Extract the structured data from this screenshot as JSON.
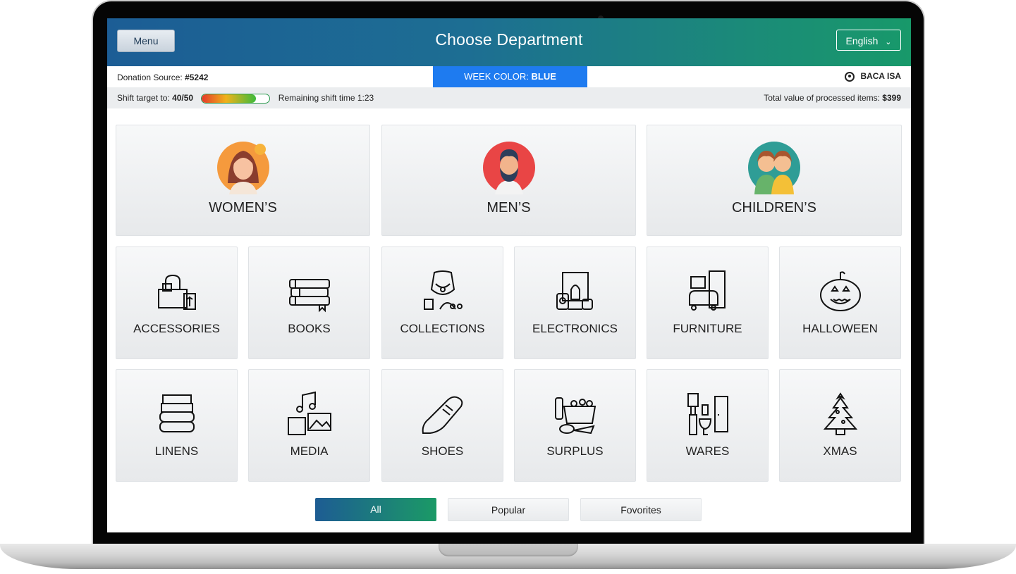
{
  "header": {
    "menu_label": "Menu",
    "title": "Choose Department",
    "language": "English"
  },
  "info": {
    "donation_source_label": "Donation Source:",
    "donation_source_value": "#5242",
    "week_color_label": "WEEK COLOR:",
    "week_color_value": "BLUE",
    "user_name": "BACA ISA",
    "shift_target_label": "Shift target to:",
    "shift_target_value": "40/50",
    "shift_progress_fraction": 0.8,
    "remaining_shift_time": "Remaining shift time 1:23",
    "total_value_label": "Total value of processed items:",
    "total_value": "$399"
  },
  "departments_main": [
    {
      "label": "WOMEN’S",
      "icon": "woman-avatar-icon"
    },
    {
      "label": "MEN’S",
      "icon": "man-avatar-icon"
    },
    {
      "label": "CHILDREN’S",
      "icon": "children-avatar-icon"
    }
  ],
  "departments_row1": [
    {
      "label": "ACCESSORIES",
      "icon": "handbag-icon"
    },
    {
      "label": "BOOKS",
      "icon": "books-icon"
    },
    {
      "label": "COLLECTIONS",
      "icon": "jewelry-icon"
    },
    {
      "label": "ELECTRONICS",
      "icon": "electronics-icon"
    },
    {
      "label": "FURNITURE",
      "icon": "furniture-icon"
    },
    {
      "label": "HALLOWEEN",
      "icon": "pumpkin-icon"
    }
  ],
  "departments_row2": [
    {
      "label": "LINENS",
      "icon": "linens-icon"
    },
    {
      "label": "MEDIA",
      "icon": "media-icon"
    },
    {
      "label": "SHOES",
      "icon": "shoe-icon"
    },
    {
      "label": "SURPLUS",
      "icon": "groceries-icon"
    },
    {
      "label": "WARES",
      "icon": "bathroom-wares-icon"
    },
    {
      "label": "XMAS",
      "icon": "christmas-tree-icon"
    }
  ],
  "filters": [
    {
      "label": "All",
      "active": true
    },
    {
      "label": "Popular",
      "active": false
    },
    {
      "label": "Fovorites",
      "active": false
    }
  ],
  "colors": {
    "header_start": "#1c5d95",
    "header_end": "#18996a",
    "week_badge": "#1e7bf0"
  }
}
